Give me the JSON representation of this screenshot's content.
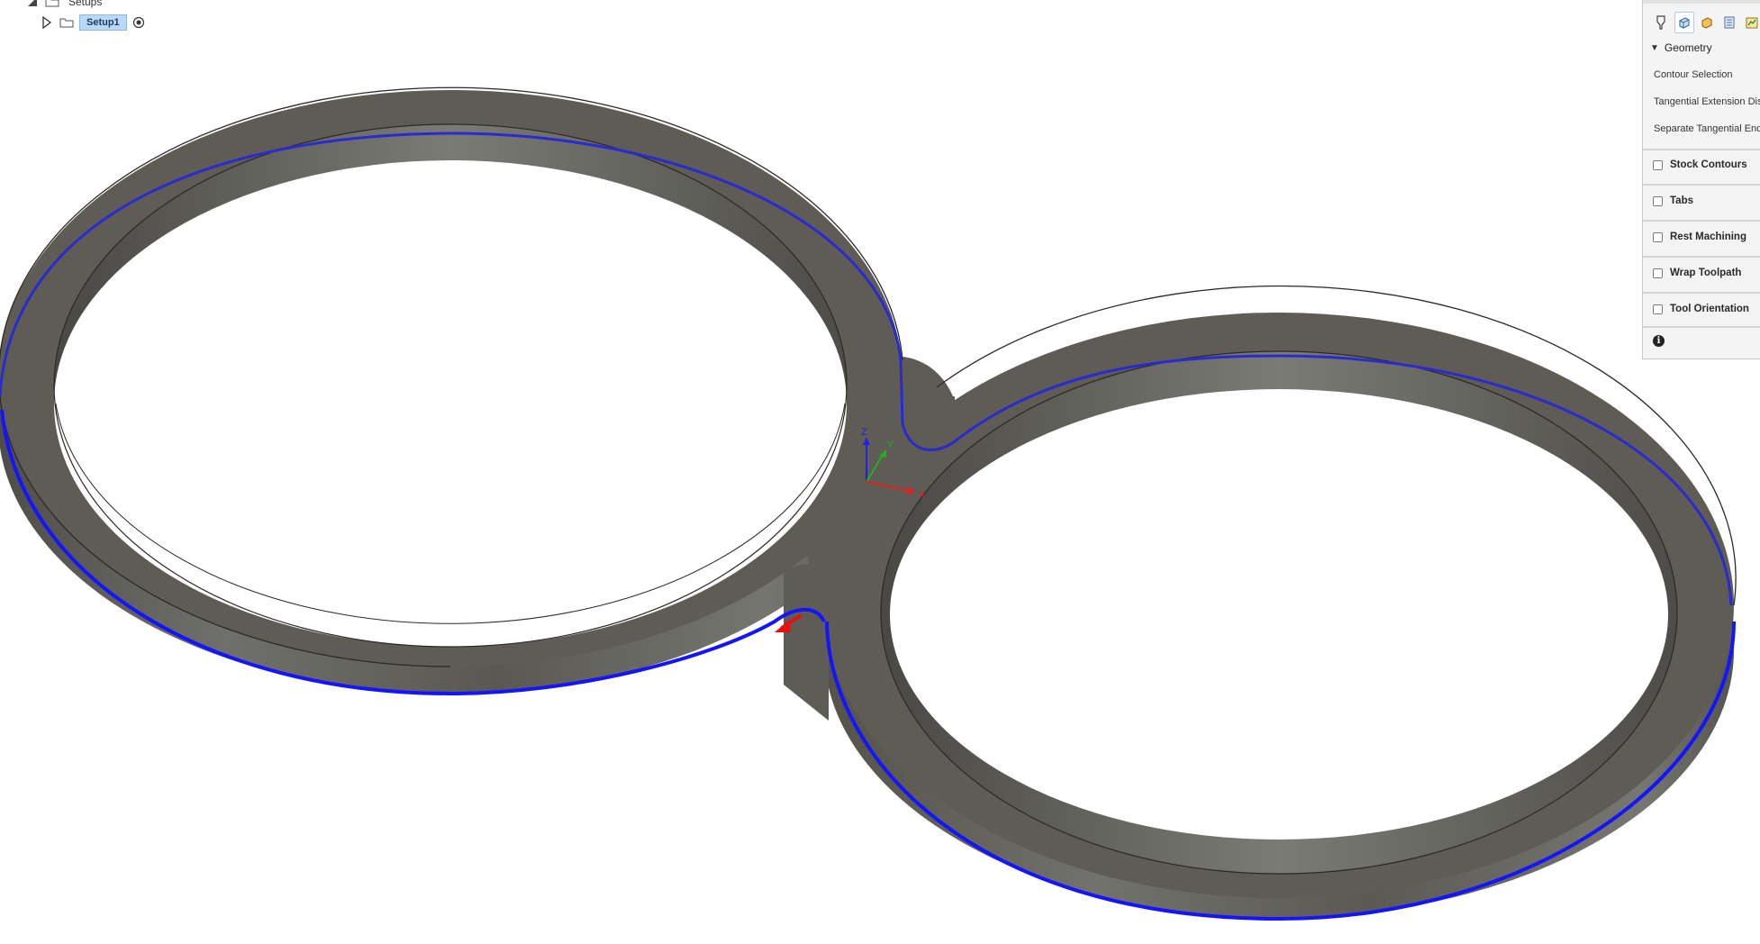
{
  "browser": {
    "setups_label": "Setups",
    "setup1_label": "Setup1"
  },
  "viewport": {
    "axis_labels": {
      "z": "Z",
      "y": "Y",
      "x": "X"
    }
  },
  "panel": {
    "geometry_label": "Geometry",
    "geometry_rows": [
      "Contour Selection",
      "Tangential Extension Dist",
      "Separate Tangential End"
    ],
    "sections": [
      {
        "label": "Stock Contours",
        "checked": false
      },
      {
        "label": "Tabs",
        "checked": false
      },
      {
        "label": "Rest Machining",
        "checked": false
      },
      {
        "label": "Wrap Toolpath",
        "checked": false
      },
      {
        "label": "Tool Orientation",
        "checked": false
      }
    ],
    "tabs": [
      "tool-tab-icon",
      "geometry-tab-icon",
      "heights-tab-icon",
      "passes-tab-icon",
      "linking-tab-icon"
    ]
  },
  "colors": {
    "part_top": "#5f5c55",
    "part_side": "#6a6a66",
    "contour_selection": "#1414ff",
    "inner_contour": "#2a2ad0",
    "arrow": "#e61010",
    "axis_x": "#e02020",
    "axis_y": "#20b020",
    "axis_z": "#2020e0",
    "panel_bg": "#f4f4f4"
  }
}
